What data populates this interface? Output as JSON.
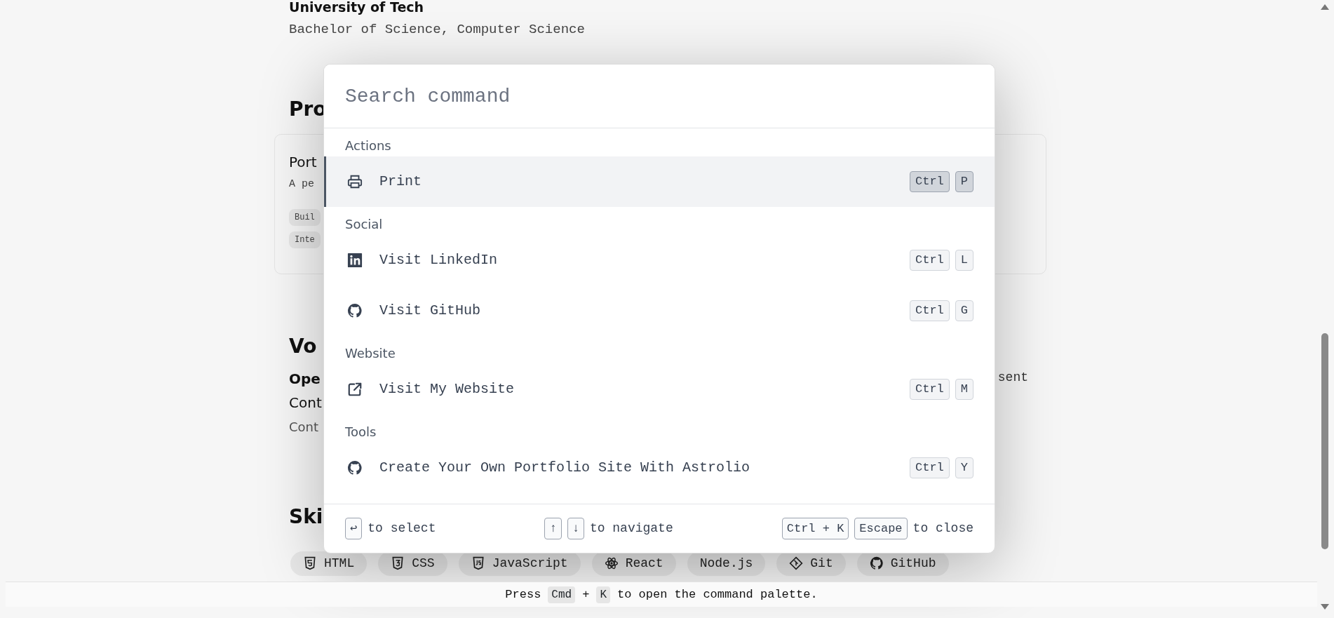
{
  "background": {
    "education": {
      "school": "University of Tech",
      "degree": "Bachelor of Science, Computer Science"
    },
    "projects": {
      "heading": "Pro",
      "card": {
        "title": "Port",
        "description": "A pe",
        "tags": [
          "Buil",
          "Inte"
        ]
      }
    },
    "volunteering": {
      "heading": "Vo",
      "role": "Ope",
      "organization": "Cont",
      "description": "Cont",
      "dates": "sent"
    },
    "skills": {
      "heading": "Ski",
      "items": [
        {
          "label": "HTML"
        },
        {
          "label": "CSS"
        },
        {
          "label": "JavaScript"
        },
        {
          "label": "React"
        },
        {
          "label": "Node.js"
        },
        {
          "label": "Git"
        },
        {
          "label": "GitHub"
        }
      ]
    }
  },
  "command_palette": {
    "search": {
      "placeholder": "Search command"
    },
    "groups": [
      {
        "label": "Actions",
        "items": [
          {
            "label": "Print",
            "shortcut": [
              "Ctrl",
              "P"
            ],
            "selected": true
          }
        ]
      },
      {
        "label": "Social",
        "items": [
          {
            "label": "Visit LinkedIn",
            "shortcut": [
              "Ctrl",
              "L"
            ],
            "selected": false
          },
          {
            "label": "Visit GitHub",
            "shortcut": [
              "Ctrl",
              "G"
            ],
            "selected": false
          }
        ]
      },
      {
        "label": "Website",
        "items": [
          {
            "label": "Visit My Website",
            "shortcut": [
              "Ctrl",
              "M"
            ],
            "selected": false
          }
        ]
      },
      {
        "label": "Tools",
        "items": [
          {
            "label": "Create Your Own Portfolio Site With Astrolio",
            "shortcut": [
              "Ctrl",
              "Y"
            ],
            "selected": false
          }
        ]
      }
    ],
    "footer": [
      {
        "keys": [
          "↩"
        ],
        "text": "to select"
      },
      {
        "keys": [
          "↑",
          "↓"
        ],
        "text": "to navigate"
      },
      {
        "keys": [
          "Ctrl + K",
          "Escape"
        ],
        "text": "to close"
      }
    ]
  },
  "hint_bar": {
    "parts": [
      {
        "kind": "text",
        "text": "Press"
      },
      {
        "kind": "key",
        "text": "Cmd"
      },
      {
        "kind": "text",
        "text": "+"
      },
      {
        "kind": "key",
        "text": "K"
      },
      {
        "kind": "text",
        "text": "to open the command palette."
      }
    ]
  }
}
